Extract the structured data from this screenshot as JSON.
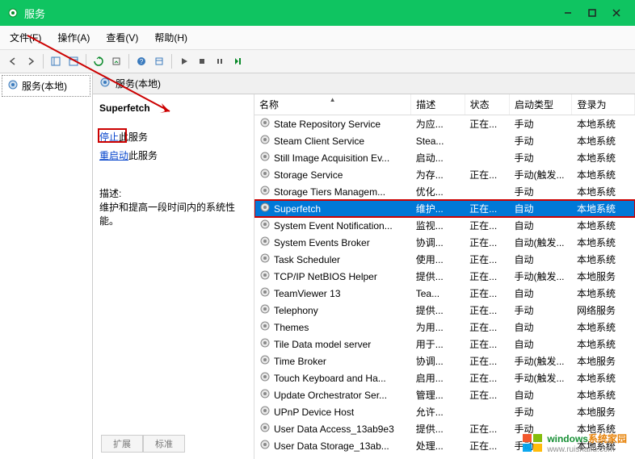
{
  "window": {
    "title": "服务"
  },
  "menu": {
    "file": "文件(F)",
    "action": "操作(A)",
    "view": "查看(V)",
    "help": "帮助(H)"
  },
  "nav": {
    "root": "服务(本地)"
  },
  "content_header": "服务(本地)",
  "panel": {
    "service_name": "Superfetch",
    "stop_link": "停止",
    "stop_suffix": "此服务",
    "restart_link": "重启动",
    "restart_suffix": "此服务",
    "desc_label": "描述:",
    "desc_text": "维护和提高一段时间内的系统性能。"
  },
  "columns": {
    "name": "名称",
    "desc": "描述",
    "status": "状态",
    "startup": "启动类型",
    "logon": "登录为"
  },
  "rows": [
    {
      "name": "State Repository Service",
      "desc": "为应...",
      "status": "正在...",
      "startup": "手动",
      "logon": "本地系统",
      "sel": false
    },
    {
      "name": "Steam Client Service",
      "desc": "Stea...",
      "status": "",
      "startup": "手动",
      "logon": "本地系统",
      "sel": false
    },
    {
      "name": "Still Image Acquisition Ev...",
      "desc": "启动...",
      "status": "",
      "startup": "手动",
      "logon": "本地系统",
      "sel": false
    },
    {
      "name": "Storage Service",
      "desc": "为存...",
      "status": "正在...",
      "startup": "手动(触发...",
      "logon": "本地系统",
      "sel": false
    },
    {
      "name": "Storage Tiers Managem...",
      "desc": "优化...",
      "status": "",
      "startup": "手动",
      "logon": "本地系统",
      "sel": false
    },
    {
      "name": "Superfetch",
      "desc": "维护...",
      "status": "正在...",
      "startup": "自动",
      "logon": "本地系统",
      "sel": true
    },
    {
      "name": "System Event Notification...",
      "desc": "监视...",
      "status": "正在...",
      "startup": "自动",
      "logon": "本地系统",
      "sel": false
    },
    {
      "name": "System Events Broker",
      "desc": "协调...",
      "status": "正在...",
      "startup": "自动(触发...",
      "logon": "本地系统",
      "sel": false
    },
    {
      "name": "Task Scheduler",
      "desc": "使用...",
      "status": "正在...",
      "startup": "自动",
      "logon": "本地系统",
      "sel": false
    },
    {
      "name": "TCP/IP NetBIOS Helper",
      "desc": "提供...",
      "status": "正在...",
      "startup": "手动(触发...",
      "logon": "本地服务",
      "sel": false
    },
    {
      "name": "TeamViewer 13",
      "desc": "Tea...",
      "status": "正在...",
      "startup": "自动",
      "logon": "本地系统",
      "sel": false
    },
    {
      "name": "Telephony",
      "desc": "提供...",
      "status": "正在...",
      "startup": "手动",
      "logon": "网络服务",
      "sel": false
    },
    {
      "name": "Themes",
      "desc": "为用...",
      "status": "正在...",
      "startup": "自动",
      "logon": "本地系统",
      "sel": false
    },
    {
      "name": "Tile Data model server",
      "desc": "用于...",
      "status": "正在...",
      "startup": "自动",
      "logon": "本地系统",
      "sel": false
    },
    {
      "name": "Time Broker",
      "desc": "协调...",
      "status": "正在...",
      "startup": "手动(触发...",
      "logon": "本地服务",
      "sel": false
    },
    {
      "name": "Touch Keyboard and Ha...",
      "desc": "启用...",
      "status": "正在...",
      "startup": "手动(触发...",
      "logon": "本地系统",
      "sel": false
    },
    {
      "name": "Update Orchestrator Ser...",
      "desc": "管理...",
      "status": "正在...",
      "startup": "自动",
      "logon": "本地系统",
      "sel": false
    },
    {
      "name": "UPnP Device Host",
      "desc": "允许...",
      "status": "",
      "startup": "手动",
      "logon": "本地服务",
      "sel": false
    },
    {
      "name": "User Data Access_13ab9e3",
      "desc": "提供...",
      "status": "正在...",
      "startup": "手动",
      "logon": "本地系统",
      "sel": false
    },
    {
      "name": "User Data Storage_13ab...",
      "desc": "处理...",
      "status": "正在...",
      "startup": "手动",
      "logon": "本地系统",
      "sel": false
    }
  ],
  "tabs": {
    "extended": "扩展",
    "standard": "标准"
  },
  "watermark": {
    "l1_a": "windows",
    "l1_b": "系统家园",
    "l2": "www.ruishaifu.com"
  }
}
